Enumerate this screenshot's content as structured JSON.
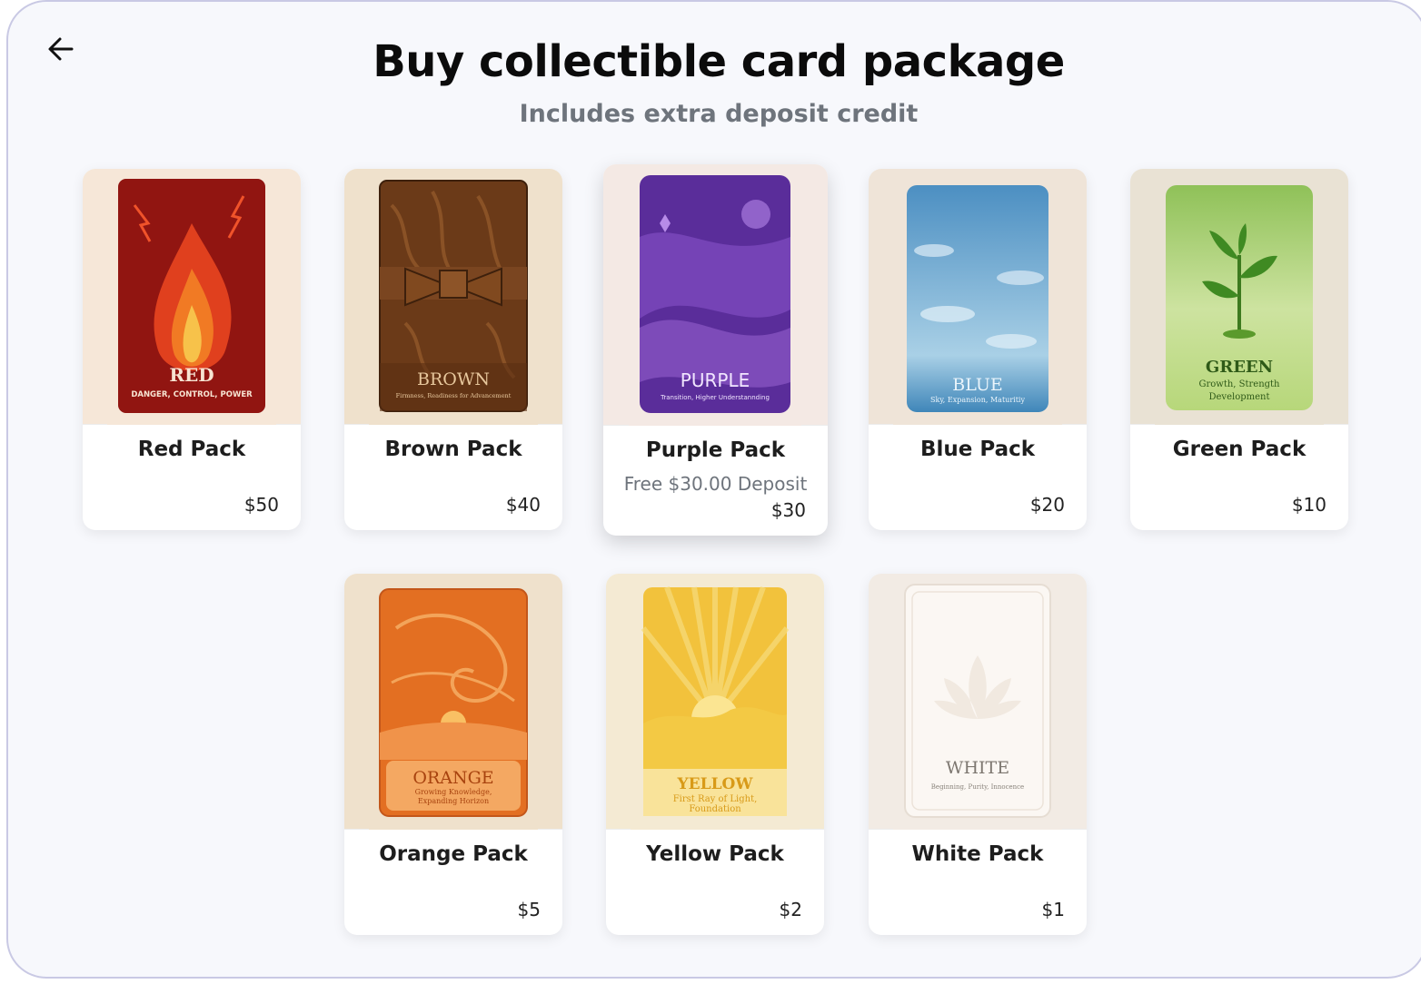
{
  "header": {
    "title": "Buy collectible card package",
    "subtitle": "Includes extra deposit credit",
    "back_icon": "arrow-left-icon"
  },
  "packs": [
    {
      "name": "Red Pack",
      "price": "$50",
      "deposit": "",
      "art_title": "RED",
      "art_sub1": "DANGER, CONTROL, POWER",
      "art_sub2": "",
      "color": "#b8261a"
    },
    {
      "name": "Brown Pack",
      "price": "$40",
      "deposit": "",
      "art_title": "BROWN",
      "art_sub1": "Firmness, Readiness for Advancement",
      "art_sub2": "",
      "color": "#6b3e1f"
    },
    {
      "name": "Purple Pack",
      "price": "$30",
      "deposit": "Free $30.00 Deposit",
      "art_title": "PURPLE",
      "art_sub1": "Transition, Higher Understannding",
      "art_sub2": "",
      "color": "#6a3fb0"
    },
    {
      "name": "Blue Pack",
      "price": "$20",
      "deposit": "",
      "art_title": "BLUE",
      "art_sub1": "Sky, Expansion, Maturitiy",
      "art_sub2": "",
      "color": "#5b9bc7"
    },
    {
      "name": "Green Pack",
      "price": "$10",
      "deposit": "",
      "art_title": "GREEN",
      "art_sub1": "Growth, Strength",
      "art_sub2": "Development",
      "color": "#7fb54a"
    },
    {
      "name": "Orange Pack",
      "price": "$5",
      "deposit": "",
      "art_title": "ORANGE",
      "art_sub1": "Growing Knowledge,",
      "art_sub2": "Expanding Horizon",
      "color": "#e7802d"
    },
    {
      "name": "Yellow Pack",
      "price": "$2",
      "deposit": "",
      "art_title": "YELLOW",
      "art_sub1": "First Ray of Light,",
      "art_sub2": "Foundation",
      "color": "#f3c63f"
    },
    {
      "name": "White Pack",
      "price": "$1",
      "deposit": "",
      "art_title": "WHITE",
      "art_sub1": "Beginning, Purity, Innocence",
      "art_sub2": "",
      "color": "#f5efea"
    }
  ]
}
